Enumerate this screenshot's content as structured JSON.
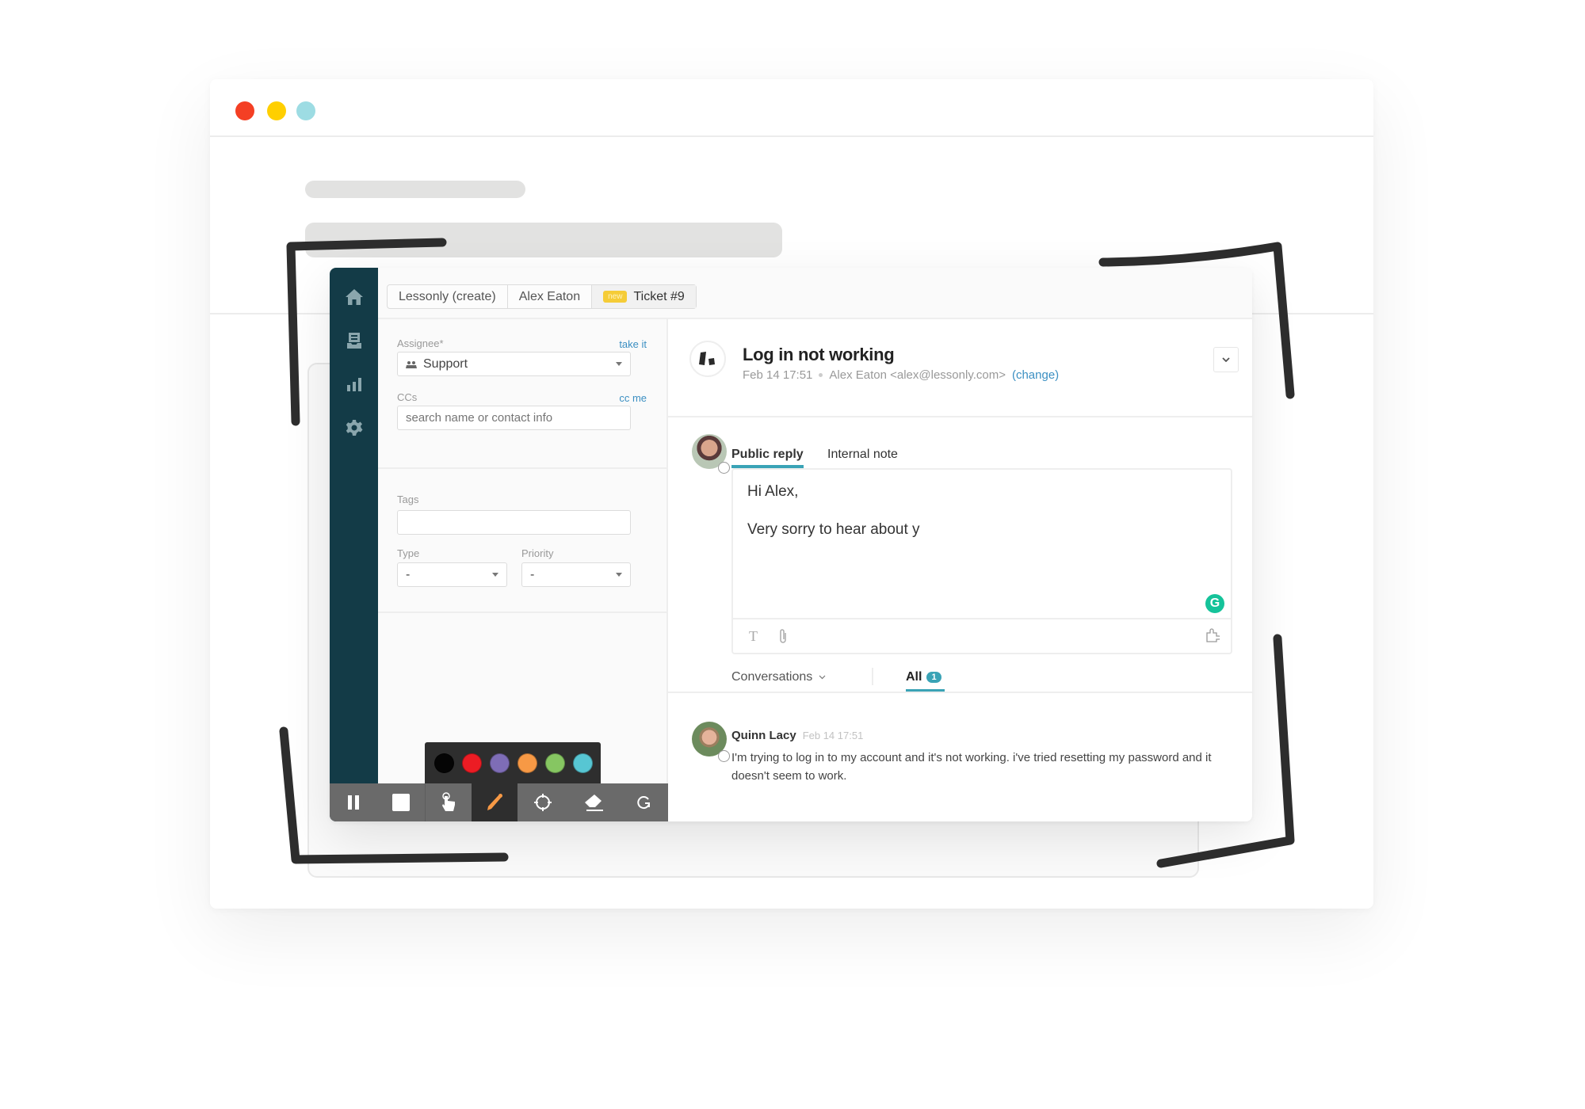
{
  "window": {
    "traffic_lights": [
      {
        "name": "close",
        "color": "#f43f24"
      },
      {
        "name": "minimize",
        "color": "#ffcf00"
      },
      {
        "name": "maximize",
        "color": "#9ddce3"
      }
    ]
  },
  "sidebar": {
    "items": [
      {
        "icon": "home-icon",
        "label": "Home"
      },
      {
        "icon": "inbox-icon",
        "label": "Views"
      },
      {
        "icon": "bar-chart-icon",
        "label": "Reporting"
      },
      {
        "icon": "gear-icon",
        "label": "Admin"
      }
    ],
    "color": "#133b47"
  },
  "breadcrumb": {
    "items": [
      "Lessonly (create)",
      "Alex Eaton",
      "Ticket #9"
    ],
    "badge": "new"
  },
  "form": {
    "assignee_label": "Assignee*",
    "take_it": "take it",
    "assignee_value": "Support",
    "ccs_label": "CCs",
    "cc_me": "cc me",
    "ccs_placeholder": "search name or contact info",
    "tags_label": "Tags",
    "tags_value": "",
    "type_label": "Type",
    "type_value": "-",
    "priority_label": "Priority",
    "priority_value": "-"
  },
  "ticket": {
    "title": "Log in not working",
    "date": "Feb 14 17:51",
    "requester": "Alex Eaton <alex@lessonly.com>",
    "change_link": "(change)"
  },
  "reply": {
    "tabs": [
      "Public reply",
      "Internal note"
    ],
    "active_tab": "Public reply",
    "line1": "Hi Alex,",
    "line2": "Very sorry to hear about y",
    "accent": "#3aa3b6"
  },
  "conversations": {
    "filter_label": "Conversations",
    "all_label": "All",
    "all_count": "1"
  },
  "messages": [
    {
      "author": "Quinn Lacy",
      "time": "Feb 14 17:51",
      "body": "I'm trying to log in to my account and it's not working. i've tried resetting my password and it doesn't seem to work."
    }
  ],
  "annotation_toolbar": {
    "palette": [
      "#050505",
      "#ec1c24",
      "#7e6db6",
      "#f79945",
      "#86c662",
      "#57c6d3"
    ],
    "tools": [
      "pause",
      "stop",
      "pointer",
      "pen",
      "crosshair",
      "eraser",
      "redo"
    ],
    "active_tool": "pen",
    "pen_color": "#f79945"
  }
}
